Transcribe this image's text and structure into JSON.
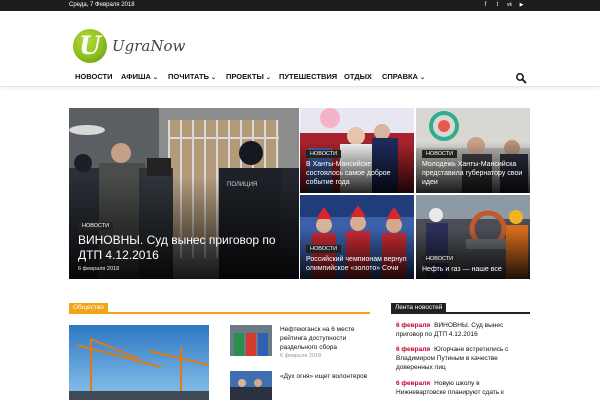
{
  "topbar": {
    "date": "Среда, 7 Февраля 2018",
    "social": [
      {
        "icon": "facebook-icon",
        "glyph": "f"
      },
      {
        "icon": "twitter-icon",
        "glyph": "t"
      },
      {
        "icon": "vk-icon",
        "glyph": "vk"
      },
      {
        "icon": "youtube-icon",
        "glyph": "▶"
      }
    ]
  },
  "brand": {
    "letter": "U",
    "name": "UgraNow",
    "color": "#8cbf1d"
  },
  "nav": {
    "items": [
      {
        "label": "НОВОСТИ",
        "has_menu": false
      },
      {
        "label": "АФИША",
        "has_menu": true
      },
      {
        "label": "ПОЧИТАТЬ",
        "has_menu": true
      },
      {
        "label": "ПРОЕКТЫ",
        "has_menu": true
      },
      {
        "label": "ПУТЕШЕСТВИЯ",
        "has_menu": false
      },
      {
        "label": "ОТДЫХ",
        "has_menu": false
      },
      {
        "label": "СПРАВКА",
        "has_menu": true
      }
    ],
    "search_icon": "search-icon"
  },
  "featured": {
    "main": {
      "category": "НОВОСТИ",
      "title": "ВИНОВНЫ. Суд вынес приговор по ДТП 4.12.2016",
      "date": "6 февраля 2018"
    },
    "tiles": [
      {
        "category": "НОВОСТИ",
        "title": "В Ханты-Мансийске состоялось самое доброе событие года"
      },
      {
        "category": "НОВОСТИ",
        "title": "Молодежь Ханты-Мансийска представила губернатору свои идеи"
      },
      {
        "category": "НОВОСТИ",
        "title": "Российский чемпионам вернул олимпийское «золото» Сочи"
      },
      {
        "category": "НОВОСТИ",
        "title": "Нефть и газ — наше все"
      }
    ]
  },
  "society": {
    "heading": "Общество",
    "items": [
      {
        "title": "Нефтеюганск на 6 месте рейтинга доступности раздельного сбора",
        "date": "6 февраля 2018"
      },
      {
        "title": "«Дух огня» ищет волонтеров",
        "date": ""
      }
    ]
  },
  "news_feed": {
    "heading": "Лента новостей",
    "items": [
      {
        "date": "6 февраля",
        "text": "ВИНОВНЫ. Суд вынес приговор по ДТП 4.12.2016"
      },
      {
        "date": "6 февраля",
        "text": "Югорчане встретились с Владимиром Путиным в качестве доверенных лиц"
      },
      {
        "date": "6 февраля",
        "text": "Новую школу в Нижневартовске планируют сдать к"
      }
    ]
  },
  "colors": {
    "accent": "#f0a416",
    "topbar": "#1d1d1d",
    "badge": "#222222",
    "feed_date": "#c3002f"
  }
}
